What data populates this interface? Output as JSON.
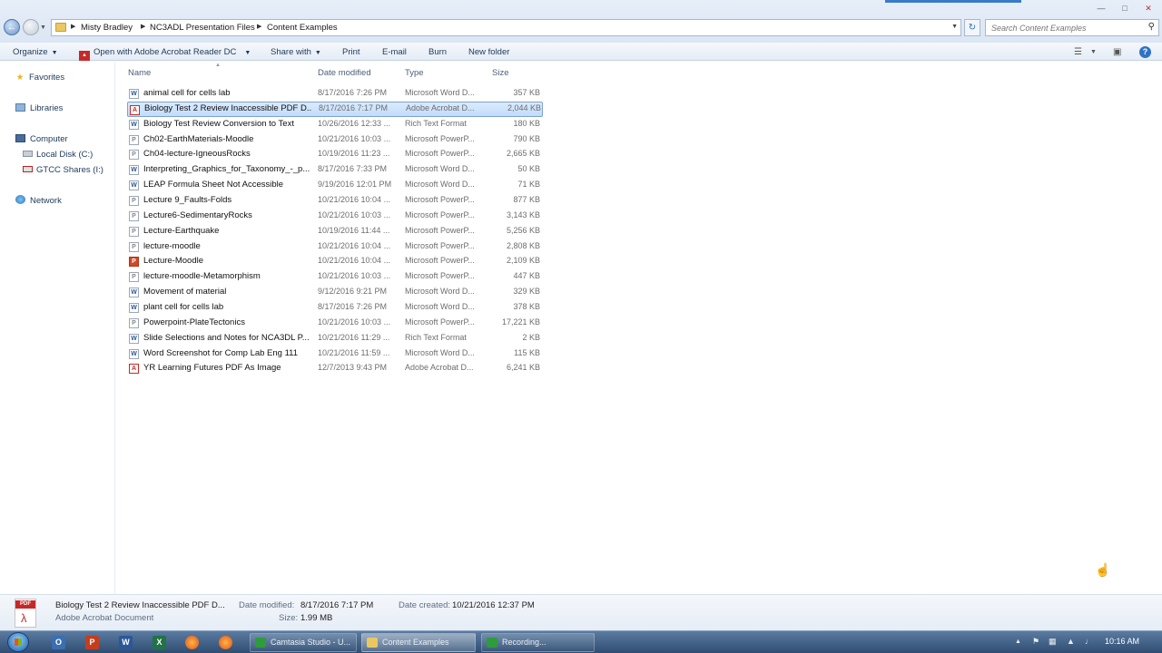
{
  "address_bar": {
    "breadcrumbs": [
      "Misty Bradley",
      "NC3ADL Presentation Files",
      "Content Examples"
    ],
    "search_placeholder": "Search Content Examples"
  },
  "command_bar": {
    "organize": "Organize",
    "open_with": "Open with Adobe Acrobat Reader DC",
    "share_with": "Share with",
    "print": "Print",
    "email": "E-mail",
    "burn": "Burn",
    "new_folder": "New folder"
  },
  "nav_pane": {
    "favorites": "Favorites",
    "libraries": "Libraries",
    "computer": "Computer",
    "local_disk": "Local Disk (C:)",
    "gtcc_shares": "GTCC Shares (I:)",
    "network": "Network"
  },
  "columns": {
    "name": "Name",
    "date": "Date modified",
    "type": "Type",
    "size": "Size"
  },
  "files": [
    {
      "name": "animal cell for cells lab",
      "date": "8/17/2016 7:26 PM",
      "type": "Microsoft Word D...",
      "size": "357 KB",
      "icon": "word"
    },
    {
      "name": "Biology Test 2 Review Inaccessible PDF D...",
      "date": "8/17/2016 7:17 PM",
      "type": "Adobe Acrobat D...",
      "size": "2,044 KB",
      "icon": "pdf",
      "selected": true
    },
    {
      "name": "Biology Test Review Conversion to Text",
      "date": "10/26/2016 12:33 ...",
      "type": "Rich Text Format",
      "size": "180 KB",
      "icon": "rtf"
    },
    {
      "name": "Ch02-EarthMaterials-Moodle",
      "date": "10/21/2016 10:03 ...",
      "type": "Microsoft PowerP...",
      "size": "790 KB",
      "icon": "ppt"
    },
    {
      "name": "Ch04-lecture-IgneousRocks",
      "date": "10/19/2016 11:23 ...",
      "type": "Microsoft PowerP...",
      "size": "2,665 KB",
      "icon": "ppt"
    },
    {
      "name": "Interpreting_Graphics_for_Taxonomy_-_p...",
      "date": "8/17/2016 7:33 PM",
      "type": "Microsoft Word D...",
      "size": "50 KB",
      "icon": "word"
    },
    {
      "name": "LEAP Formula Sheet Not Accessible",
      "date": "9/19/2016 12:01 PM",
      "type": "Microsoft Word D...",
      "size": "71 KB",
      "icon": "word"
    },
    {
      "name": "Lecture 9_Faults-Folds",
      "date": "10/21/2016 10:04 ...",
      "type": "Microsoft PowerP...",
      "size": "877 KB",
      "icon": "ppt"
    },
    {
      "name": "Lecture6-SedimentaryRocks",
      "date": "10/21/2016 10:03 ...",
      "type": "Microsoft PowerP...",
      "size": "3,143 KB",
      "icon": "ppt"
    },
    {
      "name": "Lecture-Earthquake",
      "date": "10/19/2016 11:44 ...",
      "type": "Microsoft PowerP...",
      "size": "5,256 KB",
      "icon": "ppt"
    },
    {
      "name": "lecture-moodle",
      "date": "10/21/2016 10:04 ...",
      "type": "Microsoft PowerP...",
      "size": "2,808 KB",
      "icon": "ppt"
    },
    {
      "name": "Lecture-Moodle",
      "date": "10/21/2016 10:04 ...",
      "type": "Microsoft PowerP...",
      "size": "2,109 KB",
      "icon": "pptred"
    },
    {
      "name": "lecture-moodle-Metamorphism",
      "date": "10/21/2016 10:03 ...",
      "type": "Microsoft PowerP...",
      "size": "447 KB",
      "icon": "ppt"
    },
    {
      "name": "Movement of material",
      "date": "9/12/2016 9:21 PM",
      "type": "Microsoft Word D...",
      "size": "329 KB",
      "icon": "word"
    },
    {
      "name": "plant cell for cells lab",
      "date": "8/17/2016 7:26 PM",
      "type": "Microsoft Word D...",
      "size": "378 KB",
      "icon": "word"
    },
    {
      "name": "Powerpoint-PlateTectonics",
      "date": "10/21/2016 10:03 ...",
      "type": "Microsoft PowerP...",
      "size": "17,221 KB",
      "icon": "ppt"
    },
    {
      "name": "Slide Selections and Notes for NCA3DL P...",
      "date": "10/21/2016 11:29 ...",
      "type": "Rich Text Format",
      "size": "2 KB",
      "icon": "rtf"
    },
    {
      "name": "Word Screenshot for Comp Lab Eng 111",
      "date": "10/21/2016 11:59 ...",
      "type": "Microsoft Word D...",
      "size": "115 KB",
      "icon": "word"
    },
    {
      "name": "YR Learning Futures PDF As Image",
      "date": "12/7/2013 9:43 PM",
      "type": "Adobe Acrobat D...",
      "size": "6,241 KB",
      "icon": "pdf"
    }
  ],
  "details": {
    "icon_label": "PDF",
    "name": "Biology Test 2 Review Inaccessible PDF D...",
    "type": "Adobe Acrobat Document",
    "date_modified_label": "Date modified:",
    "date_modified": "8/17/2016 7:17 PM",
    "size_label": "Size:",
    "size": "1.99 MB",
    "date_created_label": "Date created:",
    "date_created": "10/21/2016 12:37 PM"
  },
  "taskbar": {
    "windows": [
      {
        "label": "Camtasia Studio - U...",
        "color": "#2e9b3c"
      },
      {
        "label": "Content Examples",
        "color": "#e8c764",
        "active": true
      },
      {
        "label": "Recording...",
        "color": "#2e9b3c"
      }
    ],
    "clock": "10:16 AM"
  }
}
